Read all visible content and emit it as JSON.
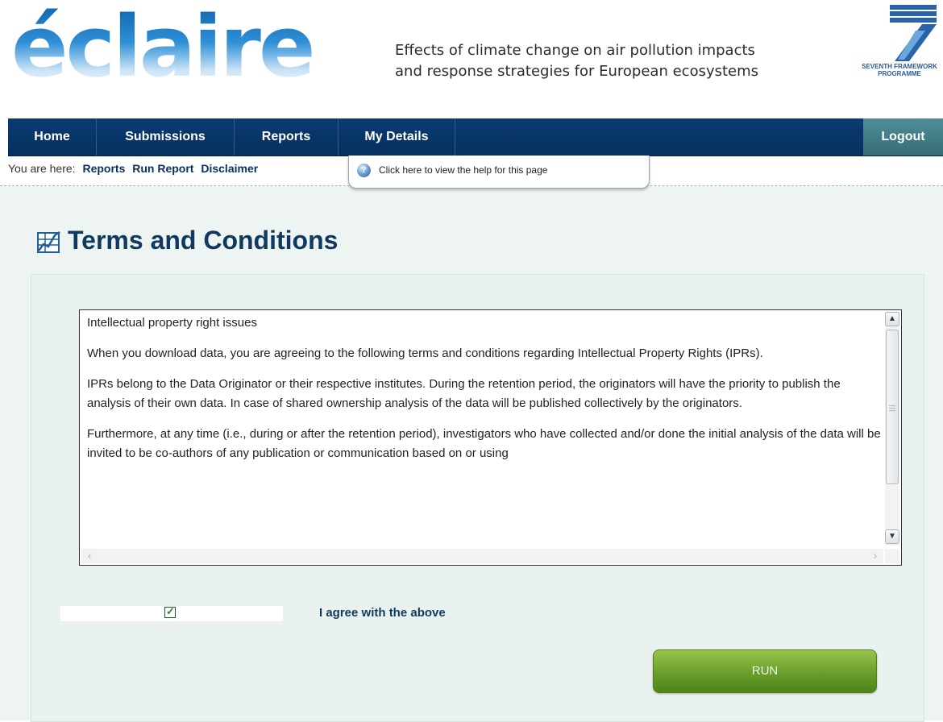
{
  "header": {
    "logo_text": "éclaire",
    "tagline_line1": "Effects of climate change on air pollution impacts",
    "tagline_line2": "and response strategies for European ecosystems",
    "fp7_line1": "SEVENTH FRAMEWORK",
    "fp7_line2": "PROGRAMME"
  },
  "nav": {
    "items": [
      {
        "label": "Home"
      },
      {
        "label": "Submissions"
      },
      {
        "label": "Reports"
      },
      {
        "label": "My Details"
      }
    ],
    "logout_label": "Logout"
  },
  "breadcrumb": {
    "prefix": "You are here:",
    "items": [
      {
        "label": "Reports"
      },
      {
        "label": "Run Report"
      },
      {
        "label": "Disclaimer"
      }
    ]
  },
  "help": {
    "text": "Click here to view the help for this page",
    "icon": "help-icon"
  },
  "page": {
    "title": "Terms and Conditions",
    "title_icon": "chart-report-icon"
  },
  "terms": {
    "paragraphs": [
      "Intellectual property right issues",
      "When you download data, you are agreeing to the following terms and conditions regarding Intellectual Property Rights (IPRs).",
      "IPRs belong to the Data Originator or their respective institutes. During the retention period, the originators will have the priority to publish the analysis of their own data. In case of shared ownership analysis of the data will be published collectively by the originators.",
      "Furthermore, at any time (i.e., during or after the retention period), investigators who have collected and/or done the initial analysis of the data will be invited to be co-authors of any publication or communication based on or using"
    ]
  },
  "agree": {
    "checked": true,
    "label": "I agree with the above"
  },
  "actions": {
    "run_label": "RUN"
  },
  "colors": {
    "nav_bg": "#06305f",
    "logout_bg": "#3f7a84",
    "title": "#10395f",
    "run_button": "#6a9e2b",
    "content_bg": "#eef4f2"
  }
}
